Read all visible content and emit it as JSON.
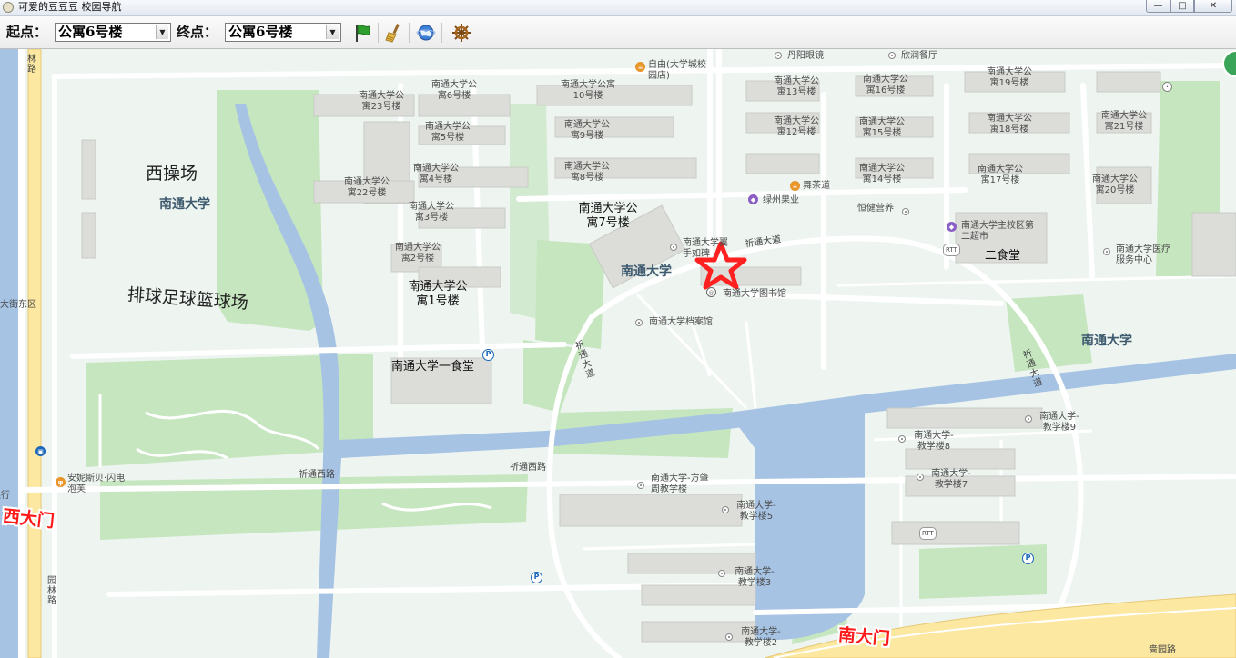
{
  "window": {
    "title": "可爱的豆豆豆 校园导航",
    "min": "—",
    "max": "□",
    "close": "✕"
  },
  "toolbar": {
    "start_label": "起点：",
    "start_value": "公寓6号楼",
    "end_label": "终点：",
    "end_value": "公寓6号楼",
    "icons": [
      "flag-icon",
      "broom-icon",
      "globe-icon",
      "helm-wheel-icon"
    ],
    "colors": {
      "flag": "#2e9e2e",
      "broom": "#d9a43a"
    }
  },
  "map": {
    "large_labels": {
      "west_field": "西操场",
      "sports_fields": "排球足球篮球场"
    },
    "brand_labels": [
      "南通大学",
      "南通大学",
      "南通大学"
    ],
    "gates": {
      "west": "西大门",
      "south": "南大门"
    },
    "gate_color": "#ff1a1a",
    "roads": {
      "qitong_ave_top": "祈通大道",
      "qitong_ave_left": "祈通大道",
      "qitong_ave_right": "祈通大道",
      "qitong_west1": "祈通西路",
      "qitong_west2": "祈通西路",
      "yuanlin_top": "林路",
      "yuanlin_bottom": "园林路",
      "nanyuan": "啬园路",
      "dajie_east": "大街东区"
    },
    "pois": {
      "danyang": "丹阳眼镜",
      "xinrun": "欣润餐厅",
      "free": "自由(大学城校园店)",
      "wucha": "舞茶道",
      "lvzhou": "绿州果业",
      "hengjian": "恒健营养",
      "erpu": "南通大学主校区第二超市",
      "ershitang": "二食堂",
      "clinic": "南通大学医疗服务中心",
      "library": "南通大学图书馆",
      "archive": "南通大学档案馆",
      "yishitang": "南通大学一食堂",
      "hand": "南通大学翼手如碑",
      "anni": "安妮斯贝·闪电泡芙",
      "bank": "银行",
      "fangzhao": "南通大学-方肇周教学楼"
    },
    "dorms": {
      "d23": "南通大学公寓23号楼",
      "d6": "南通大学公寓6号楼",
      "d5": "南通大学公寓5号楼",
      "d22": "南通大学公寓22号楼",
      "d4": "南通大学公寓4号楼",
      "d3": "南通大学公寓3号楼",
      "d2": "南通大学公寓2号楼",
      "d1": "南通大学公寓1号楼",
      "d10": "南通大学公寓10号楼",
      "d9": "南通大学公寓9号楼",
      "d8": "南通大学公寓8号楼",
      "d7": "南通大学公寓7号楼",
      "d13": "南通大学公寓13号楼",
      "d12": "南通大学公寓12号楼",
      "d16": "南通大学公寓16号楼",
      "d15": "南通大学公寓15号楼",
      "d14": "南通大学公寓14号楼",
      "d19": "南通大学公寓19号楼",
      "d18": "南通大学公寓18号楼",
      "d17": "南通大学公寓17号楼",
      "d21": "南通大学公寓21号楼",
      "d20": "南通大学公寓20号楼"
    },
    "teaching": {
      "t9": "南通大学-教学楼9",
      "t8": "南通大学-教学楼8",
      "t7": "南通大学-教学楼7",
      "t5": "南通大学-教学楼5",
      "t3": "南通大学-教学楼3",
      "t2": "南通大学-教学楼2"
    },
    "colors": {
      "water": "#a6c3e4",
      "green": "#c6e6c0",
      "road": "#ffffff",
      "building": "#dcddd9",
      "star": "#ff2020",
      "highway": "#fce8a0"
    }
  }
}
